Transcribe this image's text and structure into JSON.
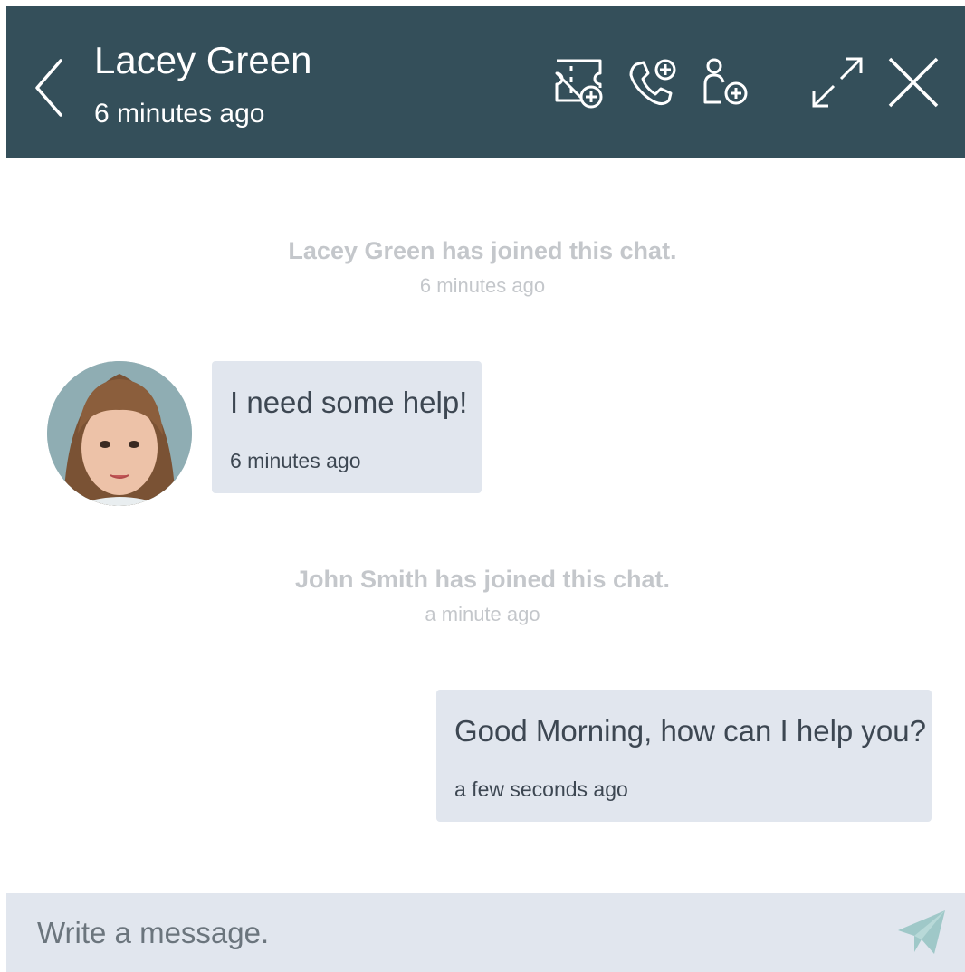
{
  "header": {
    "title": "Lacey Green",
    "subtitle": "6 minutes ago",
    "icons": [
      "back-icon",
      "add-ticket-icon",
      "add-call-icon",
      "add-participant-icon",
      "expand-icon",
      "close-icon"
    ]
  },
  "messages": {
    "system1": {
      "text": "Lacey Green has joined this chat.",
      "time": "6 minutes ago"
    },
    "incoming": {
      "text": "I need some help!",
      "time": "6 minutes ago"
    },
    "system2": {
      "text": "John Smith has joined this chat.",
      "time": "a minute ago"
    },
    "outgoing": {
      "text": "Good Morning, how can I help you?",
      "time": "a few seconds ago"
    }
  },
  "composer": {
    "placeholder": "Write a message.",
    "value": ""
  },
  "colors": {
    "header_bg": "#344f5a",
    "bubble_bg": "#e1e6ee",
    "system_text": "#c4c7cb",
    "send_icon": "#9fc8c8"
  }
}
